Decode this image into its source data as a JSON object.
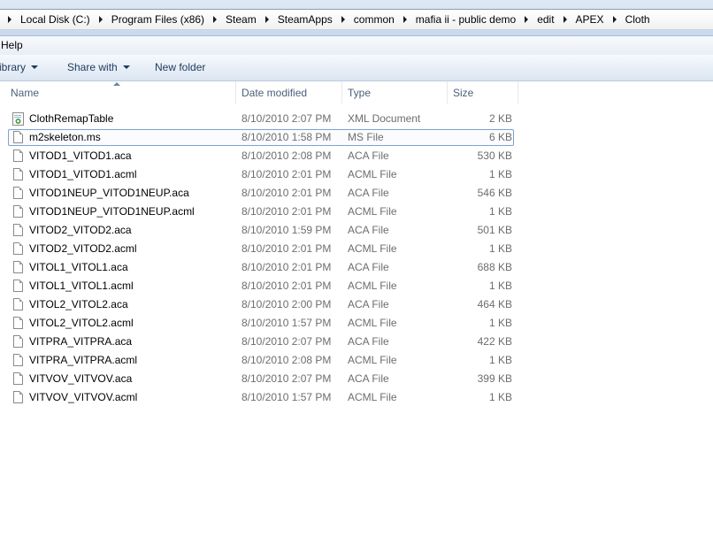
{
  "breadcrumb": [
    "Local Disk (C:)",
    "Program Files (x86)",
    "Steam",
    "SteamApps",
    "common",
    "mafia ii - public demo",
    "edit",
    "APEX",
    "Cloth"
  ],
  "menu": {
    "help": "Help"
  },
  "toolbar": {
    "library": "ibrary",
    "share_with": "Share with",
    "new_folder": "New folder"
  },
  "columns": {
    "name": "Name",
    "date": "Date modified",
    "type": "Type",
    "size": "Size"
  },
  "files": [
    {
      "name": "ClothRemapTable",
      "date": "8/10/2010 2:07 PM",
      "type": "XML Document",
      "size": "2 KB",
      "icon": "xml-document-icon"
    },
    {
      "name": "m2skeleton.ms",
      "date": "8/10/2010 1:58 PM",
      "type": "MS File",
      "size": "6 KB",
      "icon": "file-icon"
    },
    {
      "name": "VITOD1_VITOD1.aca",
      "date": "8/10/2010 2:08 PM",
      "type": "ACA File",
      "size": "530 KB",
      "icon": "file-icon"
    },
    {
      "name": "VITOD1_VITOD1.acml",
      "date": "8/10/2010 2:01 PM",
      "type": "ACML File",
      "size": "1 KB",
      "icon": "file-icon"
    },
    {
      "name": "VITOD1NEUP_VITOD1NEUP.aca",
      "date": "8/10/2010 2:01 PM",
      "type": "ACA File",
      "size": "546 KB",
      "icon": "file-icon"
    },
    {
      "name": "VITOD1NEUP_VITOD1NEUP.acml",
      "date": "8/10/2010 2:01 PM",
      "type": "ACML File",
      "size": "1 KB",
      "icon": "file-icon"
    },
    {
      "name": "VITOD2_VITOD2.aca",
      "date": "8/10/2010 1:59 PM",
      "type": "ACA File",
      "size": "501 KB",
      "icon": "file-icon"
    },
    {
      "name": "VITOD2_VITOD2.acml",
      "date": "8/10/2010 2:01 PM",
      "type": "ACML File",
      "size": "1 KB",
      "icon": "file-icon"
    },
    {
      "name": "VITOL1_VITOL1.aca",
      "date": "8/10/2010 2:01 PM",
      "type": "ACA File",
      "size": "688 KB",
      "icon": "file-icon"
    },
    {
      "name": "VITOL1_VITOL1.acml",
      "date": "8/10/2010 2:01 PM",
      "type": "ACML File",
      "size": "1 KB",
      "icon": "file-icon"
    },
    {
      "name": "VITOL2_VITOL2.aca",
      "date": "8/10/2010 2:00 PM",
      "type": "ACA File",
      "size": "464 KB",
      "icon": "file-icon"
    },
    {
      "name": "VITOL2_VITOL2.acml",
      "date": "8/10/2010 1:57 PM",
      "type": "ACML File",
      "size": "1 KB",
      "icon": "file-icon"
    },
    {
      "name": "VITPRA_VITPRA.aca",
      "date": "8/10/2010 2:07 PM",
      "type": "ACA File",
      "size": "422 KB",
      "icon": "file-icon"
    },
    {
      "name": "VITPRA_VITPRA.acml",
      "date": "8/10/2010 2:08 PM",
      "type": "ACML File",
      "size": "1 KB",
      "icon": "file-icon"
    },
    {
      "name": "VITVOV_VITVOV.aca",
      "date": "8/10/2010 2:07 PM",
      "type": "ACA File",
      "size": "399 KB",
      "icon": "file-icon"
    },
    {
      "name": "VITVOV_VITVOV.acml",
      "date": "8/10/2010 1:57 PM",
      "type": "ACML File",
      "size": "1 KB",
      "icon": "file-icon"
    }
  ]
}
